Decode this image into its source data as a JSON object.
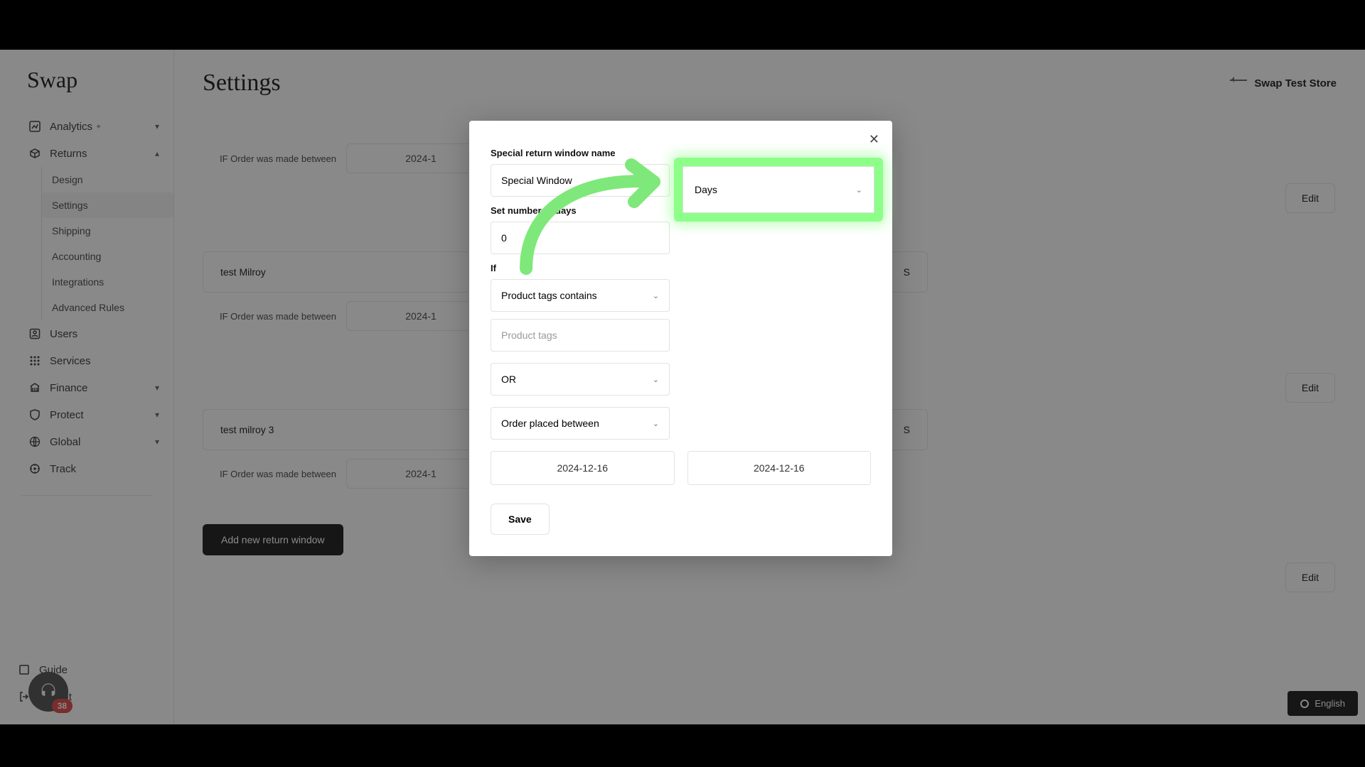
{
  "logo": "Swap",
  "nav": {
    "analytics": "Analytics",
    "returns": "Returns",
    "returns_sub": {
      "design": "Design",
      "settings": "Settings",
      "shipping": "Shipping",
      "accounting": "Accounting",
      "integrations": "Integrations",
      "advanced": "Advanced Rules"
    },
    "users": "Users",
    "services": "Services",
    "finance": "Finance",
    "protect": "Protect",
    "global": "Global",
    "track": "Track",
    "guide": "Guide",
    "logout": "Logout"
  },
  "page": {
    "title": "Settings",
    "store_switch": "Swap Test Store"
  },
  "rules": {
    "if_label": "IF Order was made between",
    "date_partial": "2024-1",
    "r1_name": "test Milroy",
    "r1_toggle_label": "S",
    "r2_name": "test milroy 3",
    "r2_toggle_label": "S",
    "edit": "Edit",
    "add_new": "Add new return window"
  },
  "modal": {
    "name_label": "Special return window name",
    "name_value": "Special Window",
    "unit_select": "Days",
    "days_label": "Set number of days",
    "days_value": "0",
    "if_label": "If",
    "condition_select": "Product tags contains",
    "tags_placeholder": "Product tags",
    "logic_select": "OR",
    "placed_select": "Order placed between",
    "date1": "2024-12-16",
    "date2": "2024-12-16",
    "save": "Save"
  },
  "chat_badge": "38",
  "language": "English"
}
